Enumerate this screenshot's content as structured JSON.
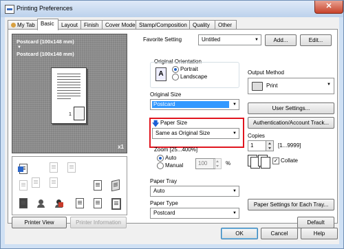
{
  "window": {
    "title": "Printing Preferences",
    "close_glyph": "✕"
  },
  "tabs": [
    {
      "label": "My Tab"
    },
    {
      "label": "Basic"
    },
    {
      "label": "Layout"
    },
    {
      "label": "Finish"
    },
    {
      "label": "Cover Mode"
    },
    {
      "label": "Stamp/Composition"
    },
    {
      "label": "Quality"
    },
    {
      "label": "Other"
    }
  ],
  "preview": {
    "label_line1": "Postcard (100x148 mm)",
    "arrow": "▼",
    "label_line2": "Postcard (100x148 mm)",
    "multiplier": "x1",
    "page_number": "1"
  },
  "favorite": {
    "label": "Favorite Setting",
    "value": "Untitled",
    "add_button": "Add...",
    "edit_button": "Edit..."
  },
  "orientation": {
    "label": "Original Orientation",
    "options": [
      "Portrait",
      "Landscape"
    ],
    "selected": "Portrait"
  },
  "original_size": {
    "label": "Original Size",
    "value": "Postcard"
  },
  "paper_size": {
    "label": "Paper Size",
    "value": "Same as Original Size"
  },
  "zoom": {
    "label": "Zoom [25...400%]",
    "options": [
      "Auto",
      "Manual"
    ],
    "selected": "Auto",
    "value": "100",
    "unit": "%"
  },
  "paper_tray": {
    "label": "Paper Tray",
    "value": "Auto"
  },
  "paper_type": {
    "label": "Paper Type",
    "value": "Postcard"
  },
  "output": {
    "label": "Output Method",
    "value": "Print"
  },
  "buttons": {
    "user_settings": "User Settings...",
    "authentication": "Authentication/Account Track...",
    "paper_settings_tray": "Paper Settings for Each Tray...",
    "printer_view": "Printer View",
    "printer_information": "Printer Information",
    "default": "Default",
    "ok": "OK",
    "cancel": "Cancel",
    "help": "Help"
  },
  "copies": {
    "label": "Copies",
    "value": "1",
    "range": "[1...9999]",
    "collate_label": "Collate",
    "collate_checked": true
  },
  "colors": {
    "highlight_frame": "#e0141e",
    "selection": "#3399ff",
    "preview_bg": "#858585"
  }
}
